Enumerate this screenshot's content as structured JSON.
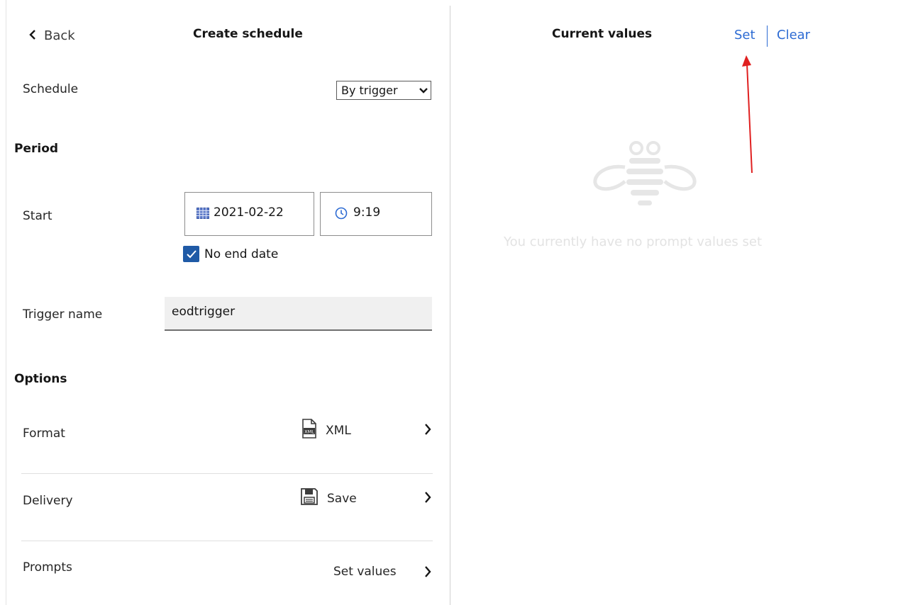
{
  "header": {
    "back_label": "Back",
    "title": "Create schedule"
  },
  "schedule": {
    "label": "Schedule",
    "selected": "By trigger"
  },
  "period": {
    "heading": "Period",
    "start_label": "Start",
    "date": "2021-02-22",
    "time": "9:19",
    "no_end_date_label": "No end date",
    "no_end_date_checked": true
  },
  "trigger": {
    "label": "Trigger name",
    "value": "eodtrigger"
  },
  "options": {
    "heading": "Options",
    "format": {
      "label": "Format",
      "value": "XML",
      "icon": "xml-file-icon"
    },
    "delivery": {
      "label": "Delivery",
      "value": "Save",
      "icon": "save-disk-icon"
    },
    "prompts": {
      "label": "Prompts",
      "value": "Set values"
    }
  },
  "current_values": {
    "title": "Current values",
    "set_label": "Set",
    "clear_label": "Clear",
    "empty_message": "You currently have no prompt values set",
    "empty_icon": "bee-icon"
  },
  "annotation": {
    "arrow_color": "#e02020"
  },
  "colors": {
    "accent": "#2d6bd3",
    "checkbox": "#1f5aa6"
  }
}
